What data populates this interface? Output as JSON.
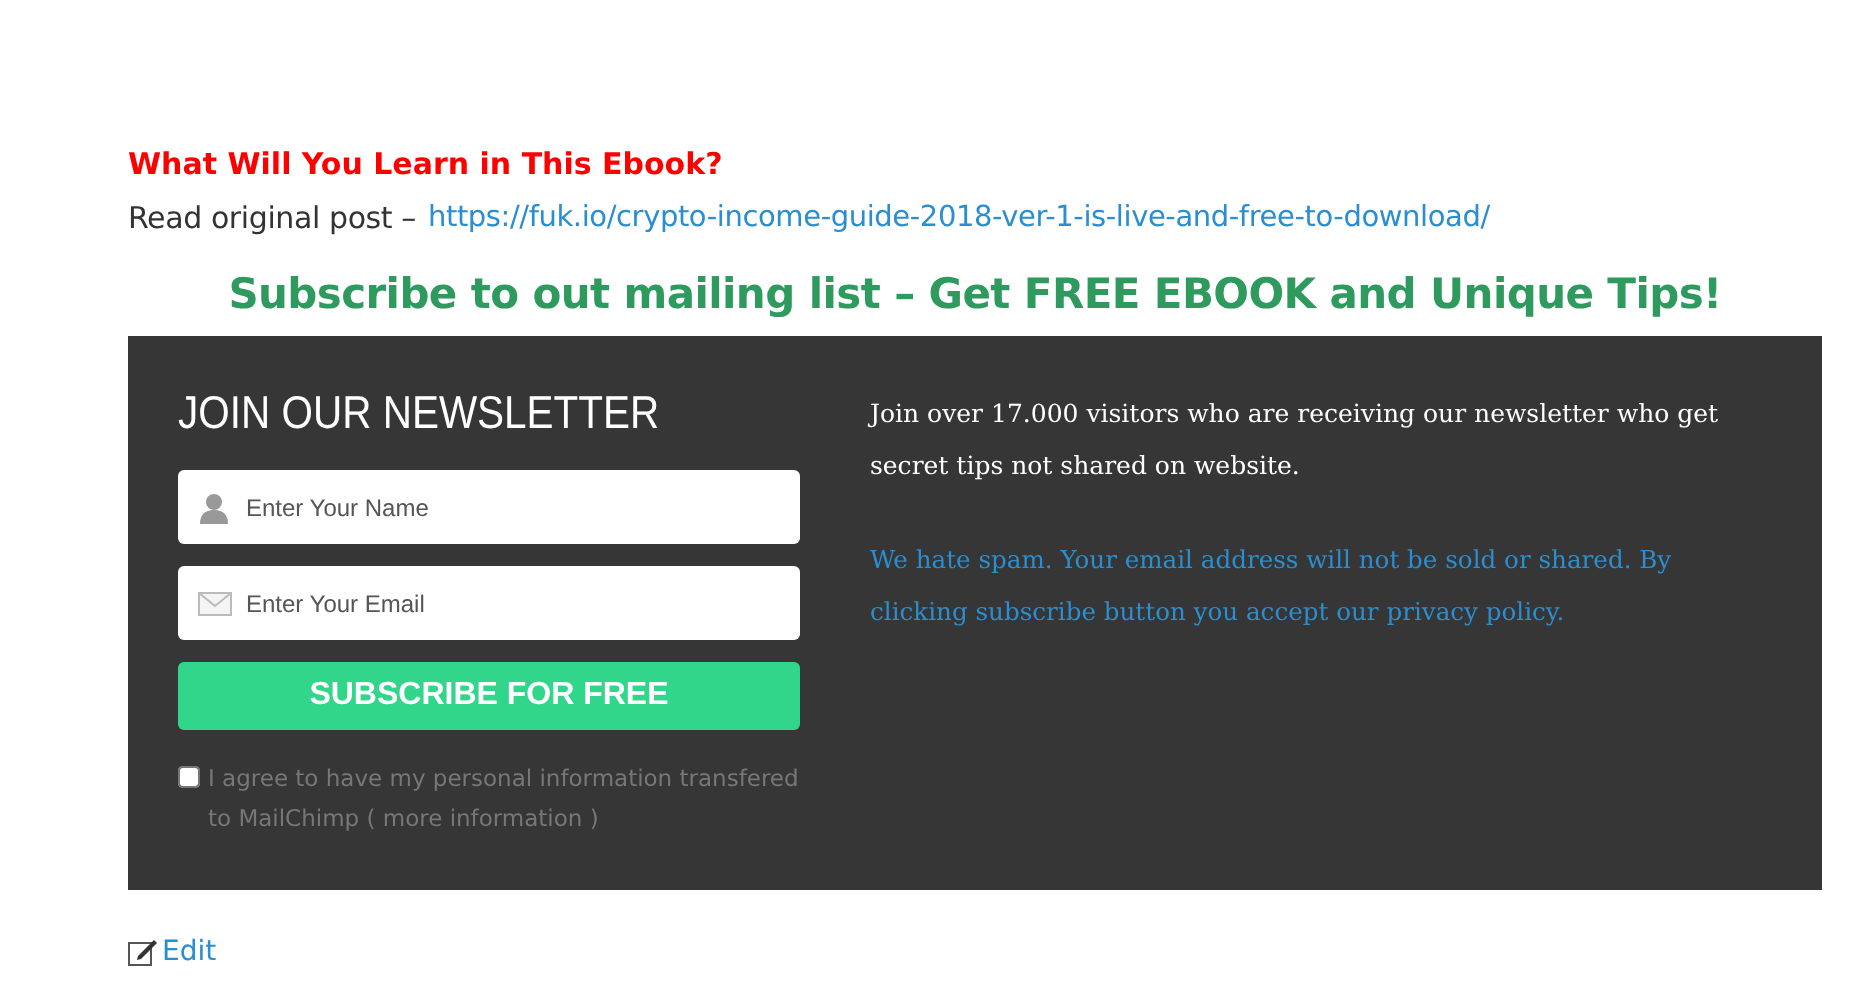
{
  "section_heading": "What Will You Learn in This Ebook?",
  "source": {
    "label": "Read original post –",
    "link": "https://fuk.io/crypto-income-guide-2018-ver-1-is-live-and-free-to-download/"
  },
  "subscribe_heading": "Subscribe to out mailing list – Get FREE EBOOK and Unique Tips!",
  "newsletter": {
    "title": "JOIN OUR NEWSLETTER",
    "fields": [
      {
        "kind": "name",
        "placeholder": "Enter Your Name"
      },
      {
        "kind": "email",
        "placeholder": "Enter Your Email"
      }
    ],
    "button": "SUBSCRIBE FOR FREE",
    "consent": {
      "checked": false,
      "text": "I agree to have my personal information transfered to MailChimp",
      "link": "( more information )"
    },
    "intro": "Join over 17.000 visitors who are receiving our newsletter who get secret tips not shared on website.",
    "notice": "We hate spam. Your email address will not be sold or shared. By clicking subscribe button you accept our privacy policy."
  },
  "edit_link": "Edit"
}
